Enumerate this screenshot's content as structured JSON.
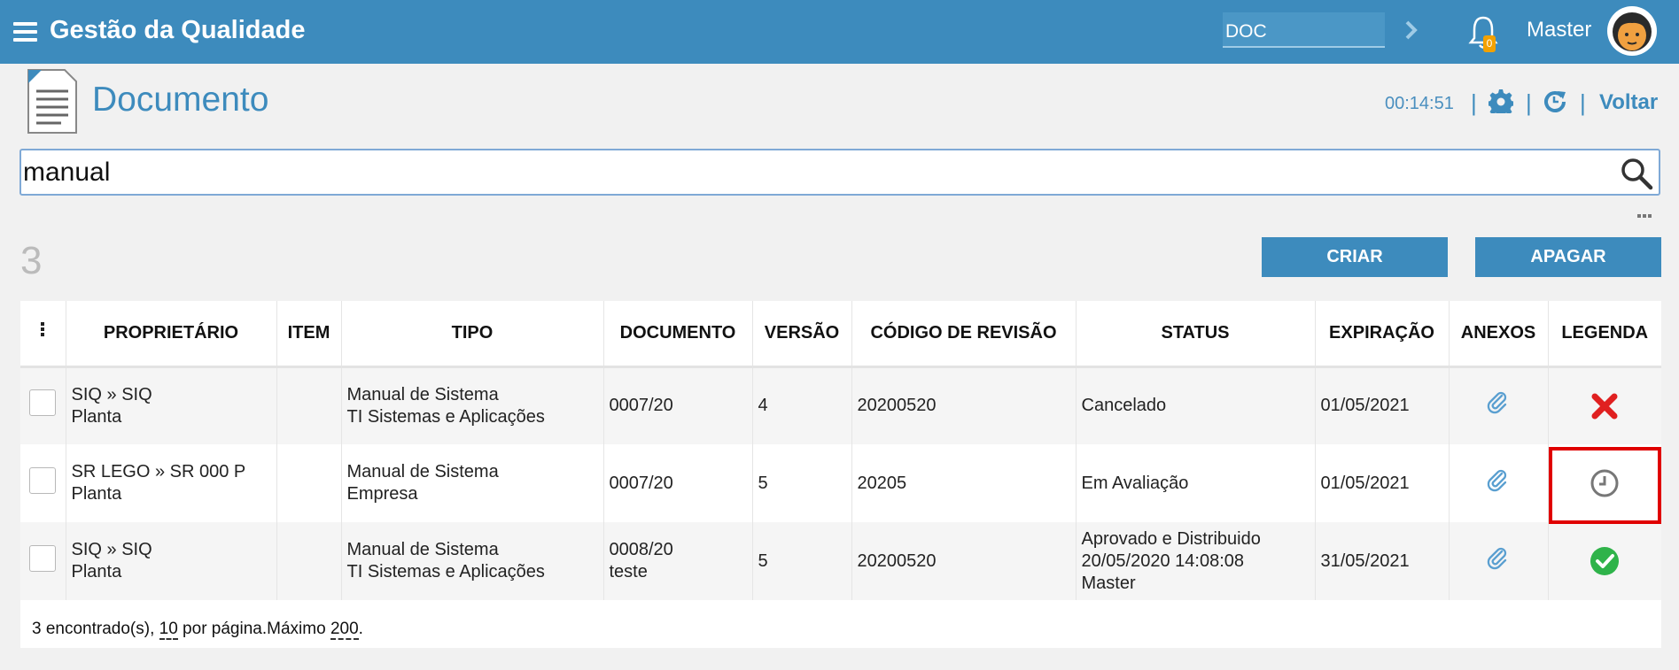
{
  "app": {
    "title": "Gestão da Qualidade",
    "module_value": "DOC",
    "notifications": "0",
    "user": "Master"
  },
  "header": {
    "title": "Documento",
    "timer": "00:14:51",
    "back": "Voltar"
  },
  "search": {
    "value": "manual"
  },
  "result_count": "3",
  "buttons": {
    "create": "CRIAR",
    "delete": "APAGAR"
  },
  "table": {
    "columns": [
      "PROPRIETÁRIO",
      "ITEM",
      "TIPO",
      "DOCUMENTO",
      "VERSÃO",
      "CÓDIGO DE REVISÃO",
      "STATUS",
      "EXPIRAÇÃO",
      "ANEXOS",
      "LEGENDA"
    ],
    "rows": [
      {
        "owner1": "SIQ » SIQ",
        "owner2": "Planta",
        "item": "",
        "type1": "Manual de Sistema",
        "type2": "TI Sistemas e Aplicações",
        "doc1": "0007/20",
        "doc2": "",
        "version": "4",
        "rev": "20200520",
        "status1": "Cancelado",
        "status2": "",
        "status3": "",
        "expiration": "01/05/2021",
        "legend": "cancelled-icon"
      },
      {
        "owner1": "SR LEGO » SR 000 P",
        "owner2": "Planta",
        "item": "",
        "type1": "Manual de Sistema",
        "type2": "Empresa",
        "doc1": "0007/20",
        "doc2": "",
        "version": "5",
        "rev": "20205",
        "status1": "Em Avaliação",
        "status2": "",
        "status3": "",
        "expiration": "01/05/2021",
        "legend": "clock-icon"
      },
      {
        "owner1": "SIQ » SIQ",
        "owner2": "Planta",
        "item": "",
        "type1": "Manual de Sistema",
        "type2": "TI Sistemas e Aplicações",
        "doc1": "0008/20",
        "doc2": "teste",
        "version": "5",
        "rev": "20200520",
        "status1": "Aprovado e Distribuido",
        "status2": "20/05/2020 14:08:08",
        "status3": "Master",
        "expiration": "31/05/2021",
        "legend": "approved-icon"
      }
    ]
  },
  "footer": {
    "found": "3 encontrado(s), ",
    "per_page_value": "10",
    "per_page_label": " por página.Máximo ",
    "max_value": "200",
    "end": "."
  },
  "colors": {
    "primary": "#3d8bbd",
    "cancelled": "#e02020",
    "approved": "#2fb34a",
    "highlight": "#e00000"
  }
}
